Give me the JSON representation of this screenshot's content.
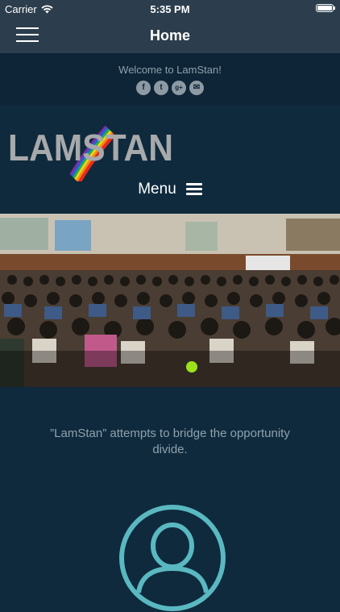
{
  "status_bar": {
    "carrier": "Carrier",
    "time": "5:35 PM",
    "battery_level": 1.0
  },
  "nav": {
    "title": "Home",
    "menu_icon": "hamburger-icon"
  },
  "welcome": {
    "text": "Welcome to LamStan!",
    "social": [
      {
        "icon": "facebook-icon",
        "glyph": "f"
      },
      {
        "icon": "twitter-icon",
        "glyph": "t"
      },
      {
        "icon": "google-plus-icon",
        "glyph": "g+"
      },
      {
        "icon": "email-icon",
        "glyph": "✉"
      }
    ]
  },
  "header": {
    "logo_text": "LAMSTAN",
    "menu_label": "Menu"
  },
  "hero": {
    "image": "classroom-students-photo",
    "active_slide_indicator_color": "#9be21a"
  },
  "tagline": "”LamStan” attempts to bridge the opportunity divide.",
  "colors": {
    "background": "#0f2a3d",
    "nav": "#2c3e4d",
    "accent": "#5ab8c0"
  }
}
